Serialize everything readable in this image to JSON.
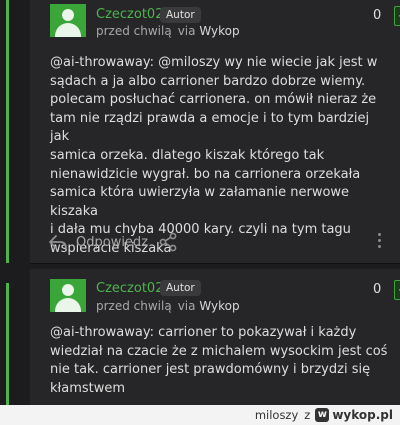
{
  "comments": [
    {
      "author": "Czeczot02",
      "badge": "Autor",
      "time": "przed chwilą",
      "via_label": "via",
      "via_app": "Wykop",
      "score": "0",
      "vote_label": "+",
      "lines": [
        "@ai-throwaway: @miloszy wy nie wiecie jak jest w",
        "sądach a ja albo carrioner bardzo dobrze wiemy.",
        "polecam posłuchać carrionera. on mówił nieraz że",
        "tam nie rządzi prawda a emocje i to tym bardziej jak",
        "samica orzeka. dlatego kiszak którego tak",
        "nienawidzicie wygrał. bo na carrionera orzekała",
        "samica która uwierzyła w załamanie nerwowe kiszaka",
        "i dała mu chyba 40000 kary. czyli na tym tagu",
        "wspieracie kiszaka"
      ],
      "reply_label": "Odpowiedz"
    },
    {
      "author": "Czeczot02",
      "badge": "Autor",
      "time": "przed chwilą",
      "via_label": "via",
      "via_app": "Wykop",
      "score": "0",
      "vote_label": "+",
      "lines": [
        "@ai-throwaway: carrioner to pokazywał i każdy",
        "wiedział na czacie że z michalem wysockim jest coś",
        "nie tak. carrioner jest prawdomówny i brzydzi się",
        "kłamstwem"
      ]
    }
  ],
  "footer": {
    "user": "miloszy",
    "separator": "z",
    "logo_letter": "w",
    "brand": "wykop.pl"
  },
  "icons": [
    "user-avatar-icon",
    "reply-arrow-icon",
    "share-icon",
    "more-vertical-icon",
    "plus-icon",
    "wykop-logo-icon"
  ],
  "colors": {
    "accent": "#4fb34f",
    "background": "#1c1c1e",
    "card": "#262628"
  }
}
